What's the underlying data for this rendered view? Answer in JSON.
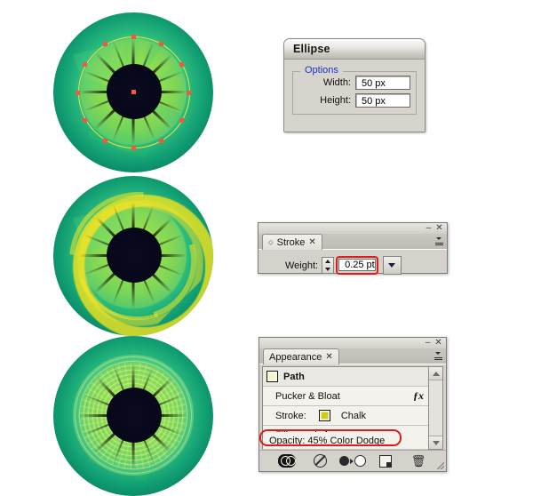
{
  "illustrations": [
    {
      "name": "eye-step-1-ellipse-path",
      "description": "green eyeball with selected yellow circle path and red anchor points",
      "anchor_count": 12,
      "anchor_color": "#f2573f",
      "path_color": "#f5e03c"
    },
    {
      "name": "eye-step-2-chalk-stroke",
      "description": "green eyeball with yellow chalk brush ring stroke",
      "chalk_color": "#f2e41e"
    },
    {
      "name": "eye-step-3-pucker-bloat",
      "description": "green eyeball with pucker & bloat color dodge texture",
      "texture_color": "#d6f696"
    }
  ],
  "colors": {
    "sclera_outer": "#00523f",
    "sclera_inner": "#6fdc5a",
    "iris": "#93e050",
    "pupil": "#0b0b1f",
    "highlight_red": "#e01b1b",
    "legend_blue": "#1b32c8"
  },
  "ellipse_dialog": {
    "title": "Ellipse",
    "options_legend": "Options",
    "fields": [
      {
        "label": "Width:",
        "value": "50 px"
      },
      {
        "label": "Height:",
        "value": "50 px"
      }
    ]
  },
  "stroke_palette": {
    "tab_label": "Stroke",
    "tab_close": "✕",
    "tab_diamond": "⬦",
    "minimize": "–",
    "close": "✕",
    "weight_label": "Weight:",
    "weight_value": "0.25 pt",
    "weight_highlighted": true
  },
  "appearance_palette": {
    "tab_label": "Appearance",
    "tab_close": "✕",
    "minimize": "–",
    "close": "✕",
    "rows": [
      {
        "label": "Path",
        "type": "header",
        "swatch": "path-swatch"
      },
      {
        "label": "Pucker & Bloat",
        "type": "effect",
        "fx": "ƒx"
      },
      {
        "label": "Stroke:",
        "type": "stroke",
        "value": "Chalk",
        "swatch": "stroke-swatch"
      },
      {
        "label": "Fill:",
        "type": "fill",
        "value": "",
        "swatch": "none-swatch"
      }
    ],
    "opacity_row": {
      "text": "Opacity: 45% Color Dodge",
      "highlighted": true
    },
    "footer_buttons": [
      "toggle-visibility-icon",
      "clear-appearance-icon",
      "duplicate-item-icon",
      "new-art-has-basic-appearance-icon",
      "delete-item-icon"
    ]
  }
}
